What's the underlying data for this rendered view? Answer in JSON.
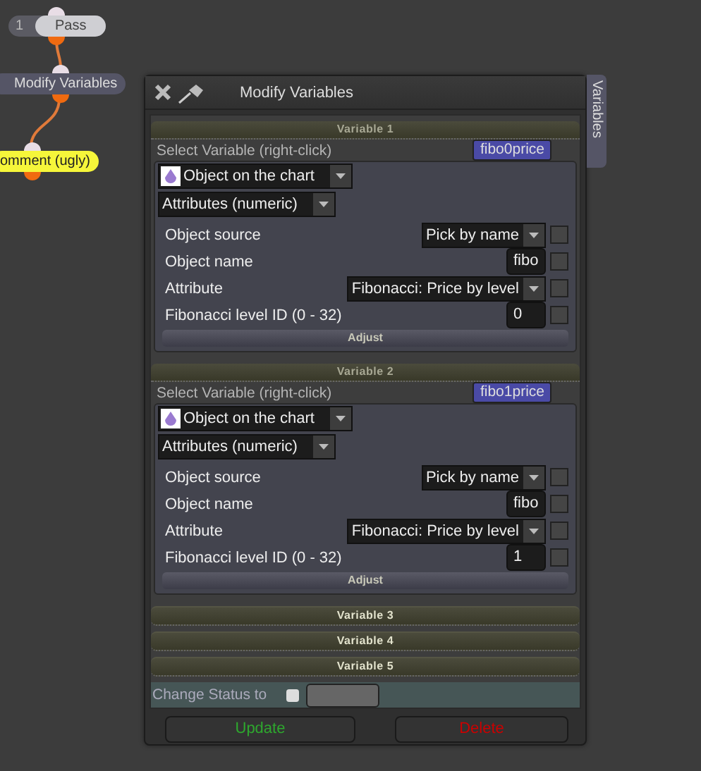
{
  "nodes": [
    {
      "kind": "pass",
      "number": "1",
      "label": "Pass"
    },
    {
      "kind": "action",
      "label": "Modify Variables"
    },
    {
      "kind": "comment",
      "label": "omment (ugly)"
    }
  ],
  "dialog": {
    "title": "Modify Variables",
    "side_tab": "Variables",
    "variables": [
      {
        "header": "Variable 1",
        "expanded": true,
        "select_label": "Select Variable (right-click)",
        "name": "fibo0price",
        "source_type": "Object on the chart",
        "value_type": "Attributes (numeric)",
        "fields": [
          {
            "kind": "dropdown",
            "label": "Object source",
            "value": "Pick by name",
            "checked": false
          },
          {
            "kind": "text",
            "label": "Object name",
            "value": "fibo",
            "checked": false
          },
          {
            "kind": "dropdown",
            "label": "Attribute",
            "value": "Fibonacci: Price by level",
            "checked": false
          },
          {
            "kind": "text",
            "label": "Fibonacci level ID (0 - 32)",
            "value": "0",
            "checked": false
          }
        ],
        "adjust": "Adjust"
      },
      {
        "header": "Variable 2",
        "expanded": true,
        "select_label": "Select Variable (right-click)",
        "name": "fibo1price",
        "source_type": "Object on the chart",
        "value_type": "Attributes (numeric)",
        "fields": [
          {
            "kind": "dropdown",
            "label": "Object source",
            "value": "Pick by name",
            "checked": false
          },
          {
            "kind": "text",
            "label": "Object name",
            "value": "fibo",
            "checked": false
          },
          {
            "kind": "dropdown",
            "label": "Attribute",
            "value": "Fibonacci: Price by level",
            "checked": false
          },
          {
            "kind": "text",
            "label": "Fibonacci level ID (0 - 32)",
            "value": "1",
            "checked": false
          }
        ],
        "adjust": "Adjust"
      },
      {
        "header": "Variable 3",
        "expanded": false
      },
      {
        "header": "Variable 4",
        "expanded": false
      },
      {
        "header": "Variable 5",
        "expanded": false
      }
    ],
    "status": {
      "label": "Change Status to",
      "checked": false
    },
    "buttons": [
      {
        "kind": "update",
        "label": "Update"
      },
      {
        "kind": "delete",
        "label": "Delete"
      }
    ]
  }
}
